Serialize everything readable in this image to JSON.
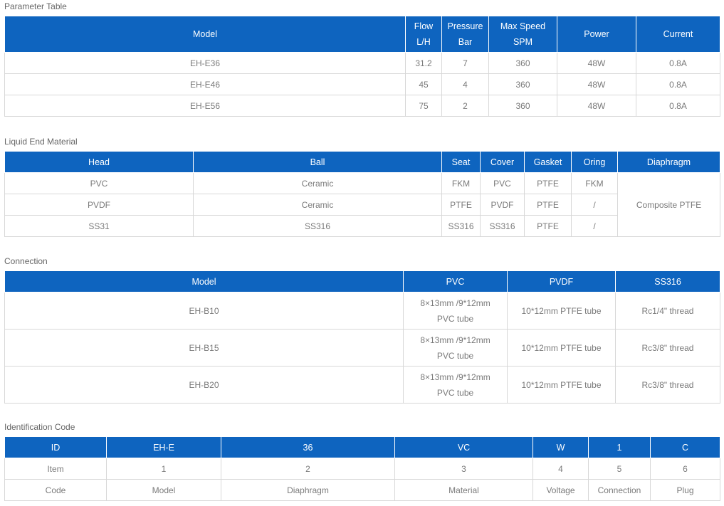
{
  "param": {
    "title": "Parameter Table",
    "headers": [
      {
        "l1": "Model",
        "l2": ""
      },
      {
        "l1": "Flow",
        "l2": "L/H"
      },
      {
        "l1": "Pressure",
        "l2": "Bar"
      },
      {
        "l1": "Max Speed",
        "l2": "SPM"
      },
      {
        "l1": "Power",
        "l2": ""
      },
      {
        "l1": "Current",
        "l2": ""
      }
    ],
    "rows": [
      [
        "EH-E36",
        "31.2",
        "7",
        "360",
        "48W",
        "0.8A"
      ],
      [
        "EH-E46",
        "45",
        "4",
        "360",
        "48W",
        "0.8A"
      ],
      [
        "EH-E56",
        "75",
        "2",
        "360",
        "48W",
        "0.8A"
      ]
    ]
  },
  "liquid": {
    "title": "Liquid End Material",
    "headers": [
      "Head",
      "Ball",
      "Seat",
      "Cover",
      "Gasket",
      "Oring",
      "Diaphragm"
    ],
    "rows": [
      [
        "PVC",
        "Ceramic",
        "FKM",
        "PVC",
        "PTFE",
        "FKM"
      ],
      [
        "PVDF",
        "Ceramic",
        "PTFE",
        "PVDF",
        "PTFE",
        "/"
      ],
      [
        "SS31",
        "SS316",
        "SS316",
        "SS316",
        "PTFE",
        "/"
      ]
    ],
    "diaphragm": "Composite PTFE"
  },
  "connection": {
    "title": "Connection",
    "headers": [
      "Model",
      "PVC",
      "PVDF",
      "SS316"
    ],
    "rows": [
      {
        "model": "EH-B10",
        "pvc1": "8×13mm /9*12mm",
        "pvc2": "PVC tube",
        "pvdf": "10*12mm PTFE tube",
        "ss": "Rc1/4\" thread"
      },
      {
        "model": "EH-B15",
        "pvc1": "8×13mm /9*12mm",
        "pvc2": "PVC tube",
        "pvdf": "10*12mm PTFE tube",
        "ss": "Rc3/8\" thread"
      },
      {
        "model": "EH-B20",
        "pvc1": "8×13mm /9*12mm",
        "pvc2": "PVC tube",
        "pvdf": "10*12mm PTFE tube",
        "ss": "Rc3/8\" thread"
      }
    ]
  },
  "ident": {
    "title": "Identification Code",
    "headers": [
      "ID",
      "EH-E",
      "36",
      "VC",
      "W",
      "1",
      "C"
    ],
    "rows": [
      [
        "Item",
        "1",
        "2",
        "3",
        "4",
        "5",
        "6"
      ],
      [
        "Code",
        "Model",
        "Diaphragm",
        "Material",
        "Voltage",
        "Connection",
        "Plug"
      ]
    ]
  }
}
